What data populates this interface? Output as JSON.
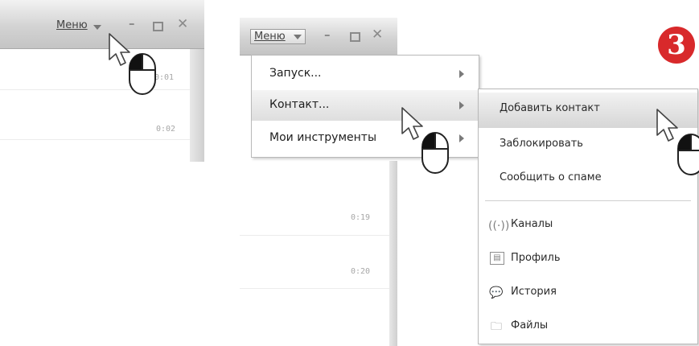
{
  "left": {
    "menu_label": "Меню",
    "timestamps": [
      "0:01",
      "0:02"
    ]
  },
  "right": {
    "menu_label": "Меню",
    "timestamps": [
      "0:19",
      "0:20"
    ],
    "step_badge": "3",
    "main_menu": [
      {
        "label": "Запуск...",
        "has_submenu": true
      },
      {
        "label": "Контакт...",
        "has_submenu": true,
        "highlighted": true
      },
      {
        "label": "Мои инструменты",
        "has_submenu": true
      }
    ],
    "submenu": [
      {
        "label": "Добавить контакт",
        "highlighted": true
      },
      {
        "label": "Заблокировать"
      },
      {
        "label": "Сообщить о спаме"
      },
      {
        "label": "Каналы",
        "icon": "channels-icon"
      },
      {
        "label": "Профиль",
        "icon": "profile-icon"
      },
      {
        "label": "История",
        "icon": "history-icon"
      },
      {
        "label": "Файлы",
        "icon": "files-icon"
      }
    ]
  },
  "icons": {
    "window_controls": [
      "minimize-icon",
      "maximize-icon",
      "close-icon"
    ],
    "pointer": "mouse-pointer-icon",
    "mouse": "mouse-left-click-icon"
  }
}
